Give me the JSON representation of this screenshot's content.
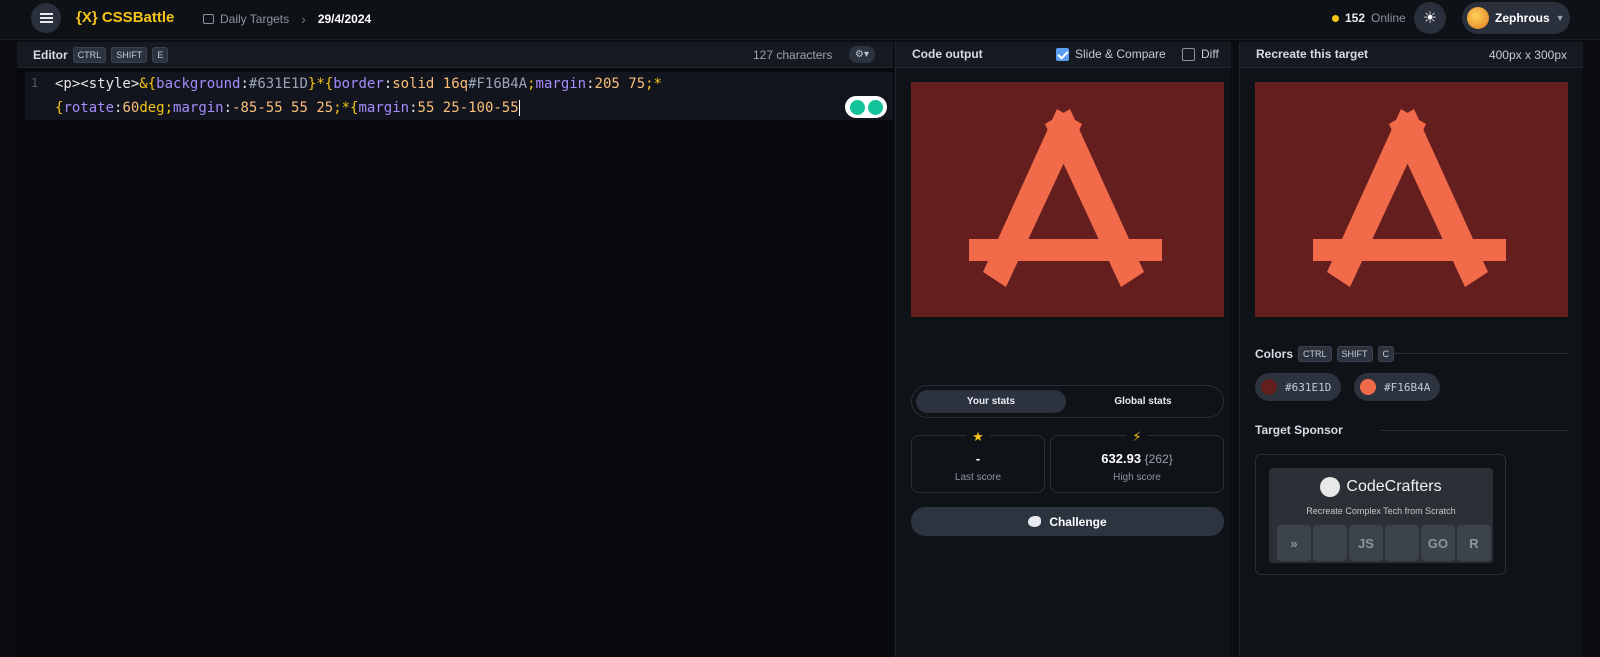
{
  "topbar": {
    "logo": "{X} CSSBattle",
    "breadcrumb_section": "Daily Targets",
    "breadcrumb_date": "29/4/2024",
    "online_count": "152",
    "online_label": "Online",
    "username": "Zephrous"
  },
  "editor": {
    "title": "Editor",
    "shortcut": [
      "CTRL",
      "SHIFT",
      "E"
    ],
    "char_count": "127 characters",
    "line_number": "1",
    "code_line1_parts": {
      "a": "<p><style>",
      "b": "&{",
      "c": "background",
      "d": ":",
      "e": "#631E1D",
      "f": "}*{",
      "g": "border",
      "h": ":",
      "i": "solid 16q",
      "j": "#F16B4A",
      "k": ";",
      "l": "margin",
      "m": ":",
      "n": "205 75",
      "o": ";*"
    },
    "code_line2_parts": {
      "a": "{",
      "b": "rotate",
      "c": ":",
      "d": "60",
      "e": "deg;",
      "f": "margin",
      "g": ":",
      "h": "-85-55 55 25",
      "i": ";*{",
      "j": "margin",
      "k": ":",
      "l": "55 25-100-55"
    }
  },
  "output": {
    "title": "Code output",
    "slide_compare": "Slide & Compare",
    "slide_compare_checked": true,
    "diff": "Diff",
    "diff_checked": false
  },
  "stats": {
    "tab_yours": "Your stats",
    "tab_global": "Global stats",
    "last_score_value": "-",
    "last_score_label": "Last score",
    "high_score_value": "632.93",
    "high_score_chars": "{262}",
    "high_score_label": "High score",
    "challenge": "Challenge"
  },
  "target": {
    "title": "Recreate this target",
    "size": "400px x 300px",
    "colors_title": "Colors",
    "colors_shortcut": [
      "CTRL",
      "SHIFT",
      "C"
    ],
    "colors": [
      {
        "hex": "#631E1D"
      },
      {
        "hex": "#F16B4A"
      }
    ],
    "sponsor_title": "Target Sponsor",
    "sponsor_brand": "CodeCrafters",
    "sponsor_tagline": "Recreate Complex Tech from Scratch",
    "sponsor_tiles": [
      "»",
      "",
      "JS",
      "",
      "GO",
      "R"
    ]
  },
  "palette": {
    "background": "#631E1D",
    "shape": "#F16B4A",
    "accent": "#F5C518"
  }
}
